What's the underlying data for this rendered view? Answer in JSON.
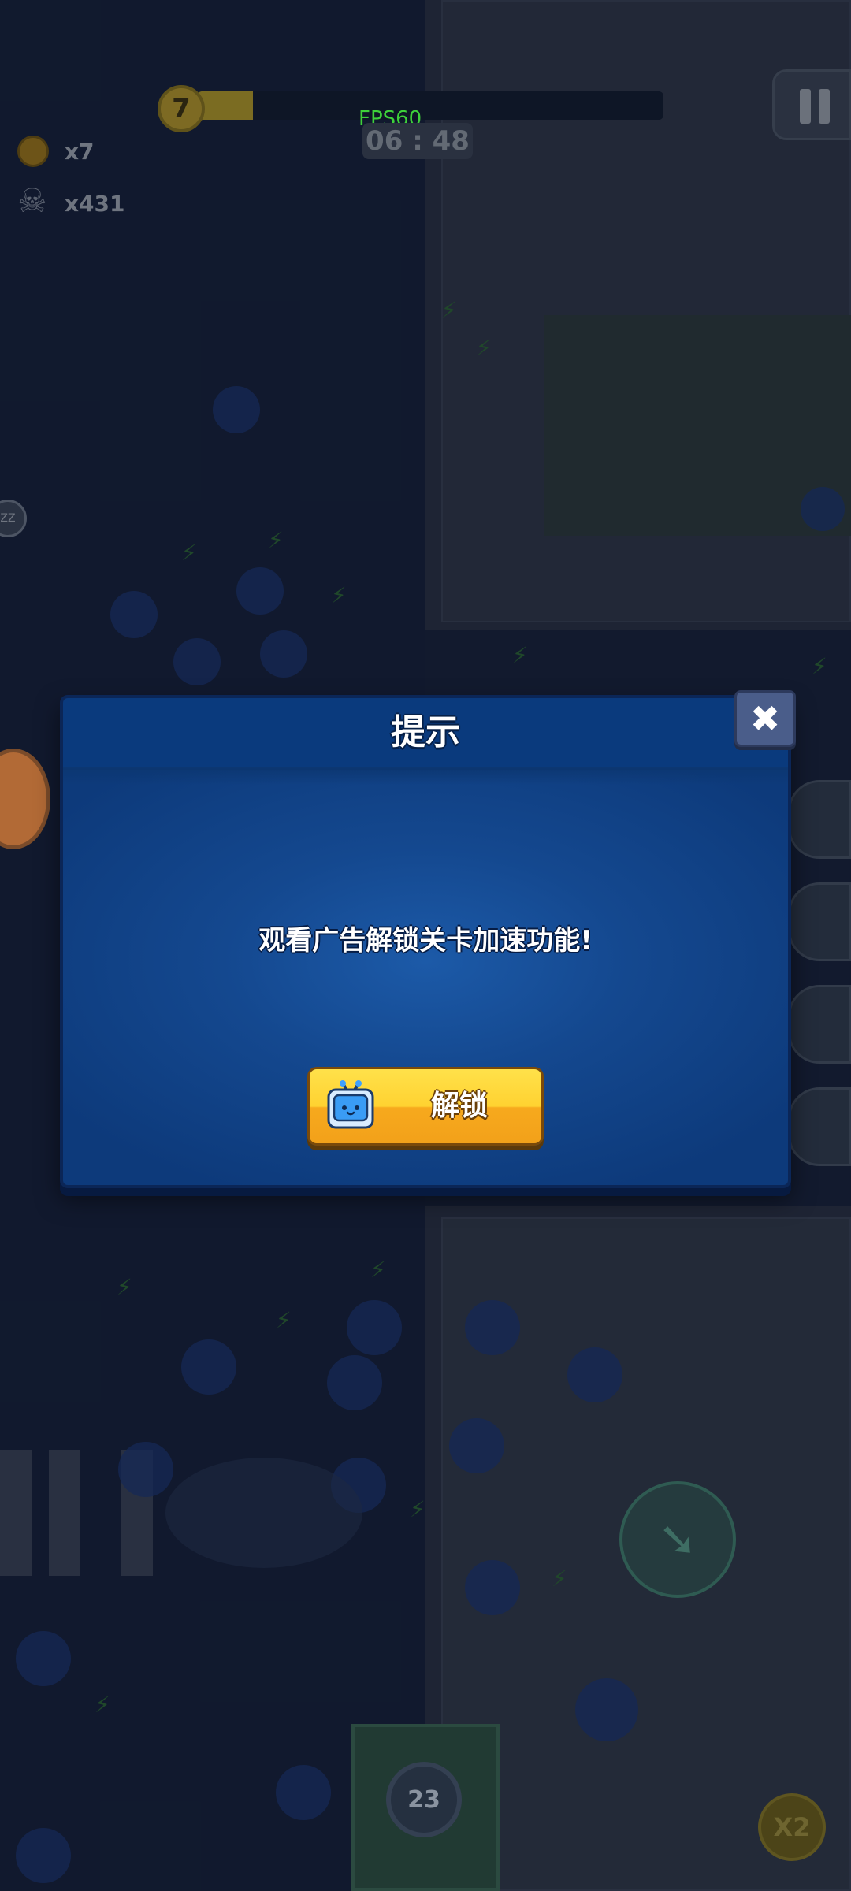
{
  "hud": {
    "fps": "FPS60",
    "timer": "06 : 48",
    "level": "7",
    "coins": "x7",
    "kills": "x431",
    "xp_progress": 0.12,
    "skill_card_count": "23",
    "speed_multiplier": "X2",
    "side_badge": "ZZ"
  },
  "dialog": {
    "title": "提示",
    "message": "观看广告解锁关卡加速功能!",
    "unlock_label": "解锁",
    "close_symbol": "✖",
    "unlock_icon": "tv-icon"
  },
  "colors": {
    "dialog_blue": "#14488f",
    "button_yellow": "#ffd231",
    "fps_green": "#3ed13a"
  }
}
